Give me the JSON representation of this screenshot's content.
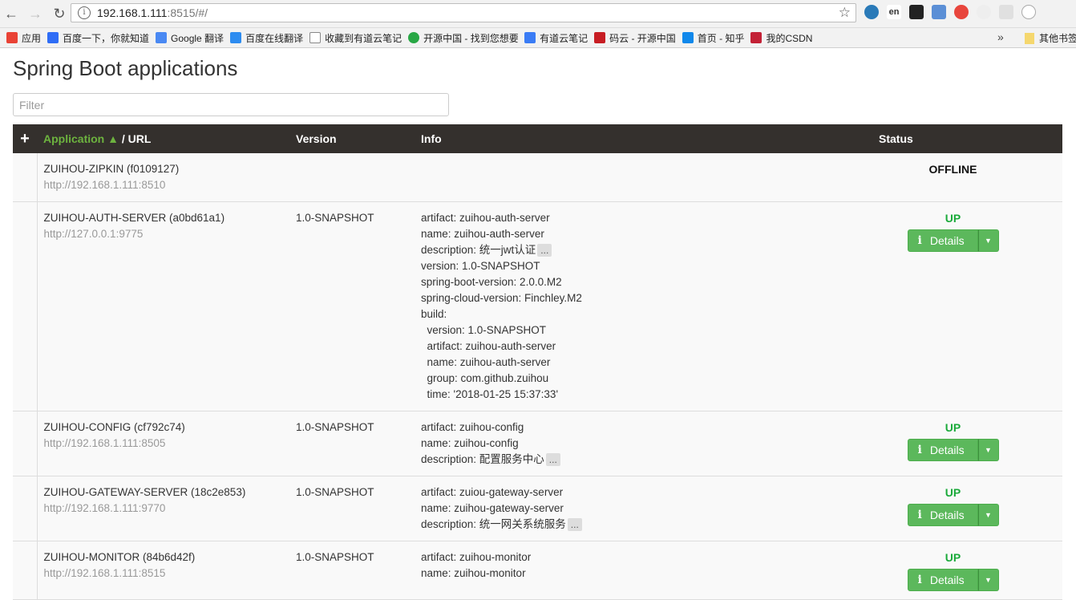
{
  "browser": {
    "url_host": "192.168.1.111",
    "url_rest": ":8515/#/",
    "bookmarks": [
      {
        "label": "应用",
        "color": "#e94235"
      },
      {
        "label": "百度一下，你就知道",
        "color": "#2f6df6"
      },
      {
        "label": "Google 翻译",
        "color": "#4a89f3"
      },
      {
        "label": "百度在线翻译",
        "color": "#2d8cf0"
      },
      {
        "label": "收藏到有道云笔记",
        "color": "#ffffff"
      },
      {
        "label": "开源中国 - 找到您想要",
        "color": "#28a745"
      },
      {
        "label": "有道云笔记",
        "color": "#3a7cf5"
      },
      {
        "label": "码云 - 开源中国",
        "color": "#c71d23"
      },
      {
        "label": "首页 - 知乎",
        "color": "#0f88eb"
      },
      {
        "label": "我的CSDN",
        "color": "#c32136"
      }
    ],
    "bookmark_more": "»",
    "bookmark_other": "其他书签"
  },
  "page": {
    "title": "Spring Boot applications",
    "filter_placeholder": "Filter"
  },
  "table": {
    "header": {
      "plus": "+",
      "application": "Application ▲",
      "url": " / URL",
      "version": "Version",
      "info": "Info",
      "status": "Status"
    },
    "details_label": "Details",
    "more_label": "...",
    "rows": [
      {
        "name": "ZUIHOU-ZIPKIN (f0109127)",
        "url": "http://192.168.1.111:8510",
        "version": "",
        "info": [],
        "info_truncated": false,
        "status": "OFFLINE"
      },
      {
        "name": "ZUIHOU-AUTH-SERVER (a0bd61a1)",
        "url": "http://127.0.0.1:9775",
        "version": "1.0-SNAPSHOT",
        "info": [
          "artifact: zuihou-auth-server",
          "name: zuihou-auth-server",
          "description: 统一jwt认证",
          "version: 1.0-SNAPSHOT",
          "spring-boot-version: 2.0.0.M2",
          "spring-cloud-version: Finchley.M2",
          "build:",
          "  version: 1.0-SNAPSHOT",
          "  artifact: zuihou-auth-server",
          "  name: zuihou-auth-server",
          "  group: com.github.zuihou",
          "  time: '2018-01-25 15:37:33'"
        ],
        "truncated_line": 2,
        "status": "UP"
      },
      {
        "name": "ZUIHOU-CONFIG (cf792c74)",
        "url": "http://192.168.1.111:8505",
        "version": "1.0-SNAPSHOT",
        "info": [
          "artifact: zuihou-config",
          "name: zuihou-config",
          "description: 配置服务中心"
        ],
        "truncated_line": 2,
        "status": "UP"
      },
      {
        "name": "ZUIHOU-GATEWAY-SERVER (18c2e853)",
        "url": "http://192.168.1.111:9770",
        "version": "1.0-SNAPSHOT",
        "info": [
          "artifact: zuiou-gateway-server",
          "name: zuihou-gateway-server",
          "description: 统一网关系统服务"
        ],
        "truncated_line": 2,
        "status": "UP"
      },
      {
        "name": "ZUIHOU-MONITOR (84b6d42f)",
        "url": "http://192.168.1.111:8515",
        "version": "1.0-SNAPSHOT",
        "info": [
          "artifact: zuihou-monitor",
          "name: zuihou-monitor"
        ],
        "truncated_line": -1,
        "status": "UP"
      }
    ]
  },
  "colors": {
    "header_bg": "#34302d",
    "sort_accent": "#6db33f",
    "up_green": "#1aaa3a",
    "button_green": "#5cb85c"
  }
}
